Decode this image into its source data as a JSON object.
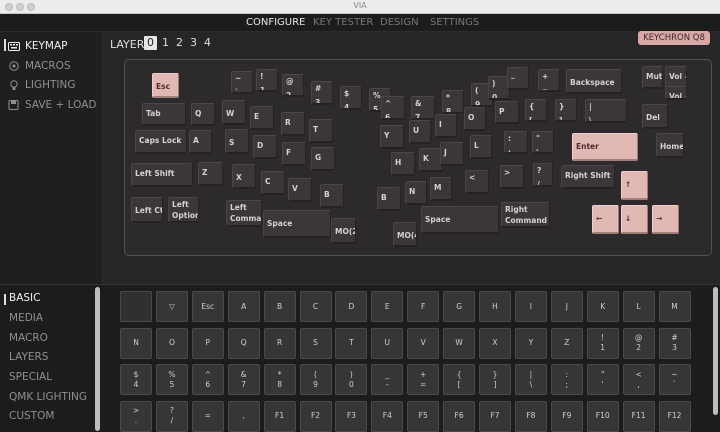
{
  "window": {
    "title": "VIA"
  },
  "nav": {
    "tabs": [
      "CONFIGURE",
      "KEY TESTER",
      "DESIGN",
      "SETTINGS"
    ],
    "active": "CONFIGURE"
  },
  "sidebar": {
    "items": [
      {
        "label": "KEYMAP",
        "icon": "keyboard-icon",
        "active": true
      },
      {
        "label": "MACROS",
        "icon": "macro-icon"
      },
      {
        "label": "LIGHTING",
        "icon": "bulb-icon"
      },
      {
        "label": "SAVE + LOAD",
        "icon": "save-icon"
      }
    ]
  },
  "layers": {
    "label": "LAYER",
    "numbers": [
      "0",
      "1",
      "2",
      "3",
      "4"
    ],
    "active": "0"
  },
  "keyboard_name": "KEYCHRON Q8",
  "keys": {
    "esc": [
      "Esc"
    ],
    "grave": [
      "~",
      "`"
    ],
    "k1": [
      "!",
      "1"
    ],
    "k2": [
      "@",
      "2"
    ],
    "k3": [
      "#",
      "3"
    ],
    "k4": [
      "$",
      "4"
    ],
    "k5": [
      "%",
      "5"
    ],
    "k6": [
      "^",
      "6"
    ],
    "k7": [
      "&",
      "7"
    ],
    "k8": [
      "*",
      "8"
    ],
    "k9": [
      "(",
      "9"
    ],
    "k0": [
      ")",
      "0"
    ],
    "minus": [
      "_",
      "-"
    ],
    "equal": [
      "+",
      "="
    ],
    "backspace": [
      "Backspace"
    ],
    "mute": [
      "Mute"
    ],
    "voldn": [
      "Vol -"
    ],
    "volup": [
      "Vol +"
    ],
    "tab": [
      "Tab"
    ],
    "q": [
      "Q"
    ],
    "w": [
      "W"
    ],
    "e": [
      "E"
    ],
    "r": [
      "R"
    ],
    "t": [
      "T"
    ],
    "y": [
      "Y"
    ],
    "u": [
      "U"
    ],
    "i": [
      "I"
    ],
    "o": [
      "O"
    ],
    "p": [
      "P"
    ],
    "lbr": [
      "{",
      "["
    ],
    "rbr": [
      "}",
      "]"
    ],
    "bslash": [
      "|",
      "\\"
    ],
    "del": [
      "Del"
    ],
    "caps": [
      "Caps Lock"
    ],
    "a": [
      "A"
    ],
    "s": [
      "S"
    ],
    "d": [
      "D"
    ],
    "f": [
      "F"
    ],
    "g": [
      "G"
    ],
    "h": [
      "H"
    ],
    "j": [
      "J"
    ],
    "k": [
      "K"
    ],
    "l": [
      "L"
    ],
    "semi": [
      ":",
      ";"
    ],
    "quote": [
      "\"",
      "'"
    ],
    "enter": [
      "Enter"
    ],
    "home": [
      "Home"
    ],
    "lshift": [
      "Left Shift"
    ],
    "z": [
      "Z"
    ],
    "x": [
      "X"
    ],
    "c": [
      "C"
    ],
    "v": [
      "V"
    ],
    "b": [
      "B"
    ],
    "b2": [
      "B"
    ],
    "n": [
      "N"
    ],
    "m": [
      "M"
    ],
    "comma": [
      "<",
      ","
    ],
    "dot": [
      ">",
      "."
    ],
    "slash": [
      "?",
      "/"
    ],
    "rshift": [
      "Right Shift"
    ],
    "up": [
      "↑"
    ],
    "lctrl": [
      "Left Ctrl"
    ],
    "lopt": [
      "Left",
      "Option"
    ],
    "lcmd": [
      "Left",
      "Command"
    ],
    "space1": [
      "Space"
    ],
    "mo2": [
      "MO(2)"
    ],
    "mo4": [
      "MO(4)"
    ],
    "space2": [
      "Space"
    ],
    "rcmd": [
      "Right",
      "Command"
    ],
    "left": [
      "←"
    ],
    "down": [
      "↓"
    ],
    "right": [
      "→"
    ]
  },
  "bottom": {
    "categories": [
      "BASIC",
      "MEDIA",
      "MACRO",
      "LAYERS",
      "SPECIAL",
      "QMK LIGHTING",
      "CUSTOM"
    ],
    "active": "BASIC",
    "palette": [
      [
        [
          ""
        ],
        [
          "▽"
        ],
        [
          "Esc"
        ],
        [
          "A"
        ],
        [
          "B"
        ],
        [
          "C"
        ],
        [
          "D"
        ],
        [
          "E"
        ],
        [
          "F"
        ],
        [
          "G"
        ],
        [
          "H"
        ],
        [
          "I"
        ],
        [
          "J"
        ],
        [
          "K"
        ],
        [
          "L"
        ],
        [
          "M"
        ]
      ],
      [
        [
          "N"
        ],
        [
          "O"
        ],
        [
          "P"
        ],
        [
          "Q"
        ],
        [
          "R"
        ],
        [
          "S"
        ],
        [
          "T"
        ],
        [
          "U"
        ],
        [
          "V"
        ],
        [
          "W"
        ],
        [
          "X"
        ],
        [
          "Y"
        ],
        [
          "Z"
        ],
        [
          "!",
          "1"
        ],
        [
          "@",
          "2"
        ],
        [
          "#",
          "3"
        ]
      ],
      [
        [
          "$",
          "4"
        ],
        [
          "%",
          "5"
        ],
        [
          "^",
          "6"
        ],
        [
          "&",
          "7"
        ],
        [
          "*",
          "8"
        ],
        [
          "(",
          "9"
        ],
        [
          ")",
          "0"
        ],
        [
          "_",
          "-"
        ],
        [
          "+",
          "="
        ],
        [
          "{",
          "["
        ],
        [
          "}",
          "]"
        ],
        [
          "|",
          "\\"
        ],
        [
          ":",
          ";"
        ],
        [
          "\"",
          "'"
        ],
        [
          "<",
          ","
        ],
        [
          "~",
          "`"
        ]
      ],
      [
        [
          ">",
          "."
        ],
        [
          "?",
          "/"
        ],
        [
          "="
        ],
        [
          ","
        ],
        [
          "F1"
        ],
        [
          "F2"
        ],
        [
          "F3"
        ],
        [
          "F4"
        ],
        [
          "F5"
        ],
        [
          "F6"
        ],
        [
          "F7"
        ],
        [
          "F8"
        ],
        [
          "F9"
        ],
        [
          "F10"
        ],
        [
          "F11"
        ],
        [
          "F12"
        ]
      ]
    ]
  },
  "colors": {
    "accent": "#e2b8b4",
    "badge": "#d9a7a5",
    "key": "#3c3638",
    "background": "#232323"
  }
}
